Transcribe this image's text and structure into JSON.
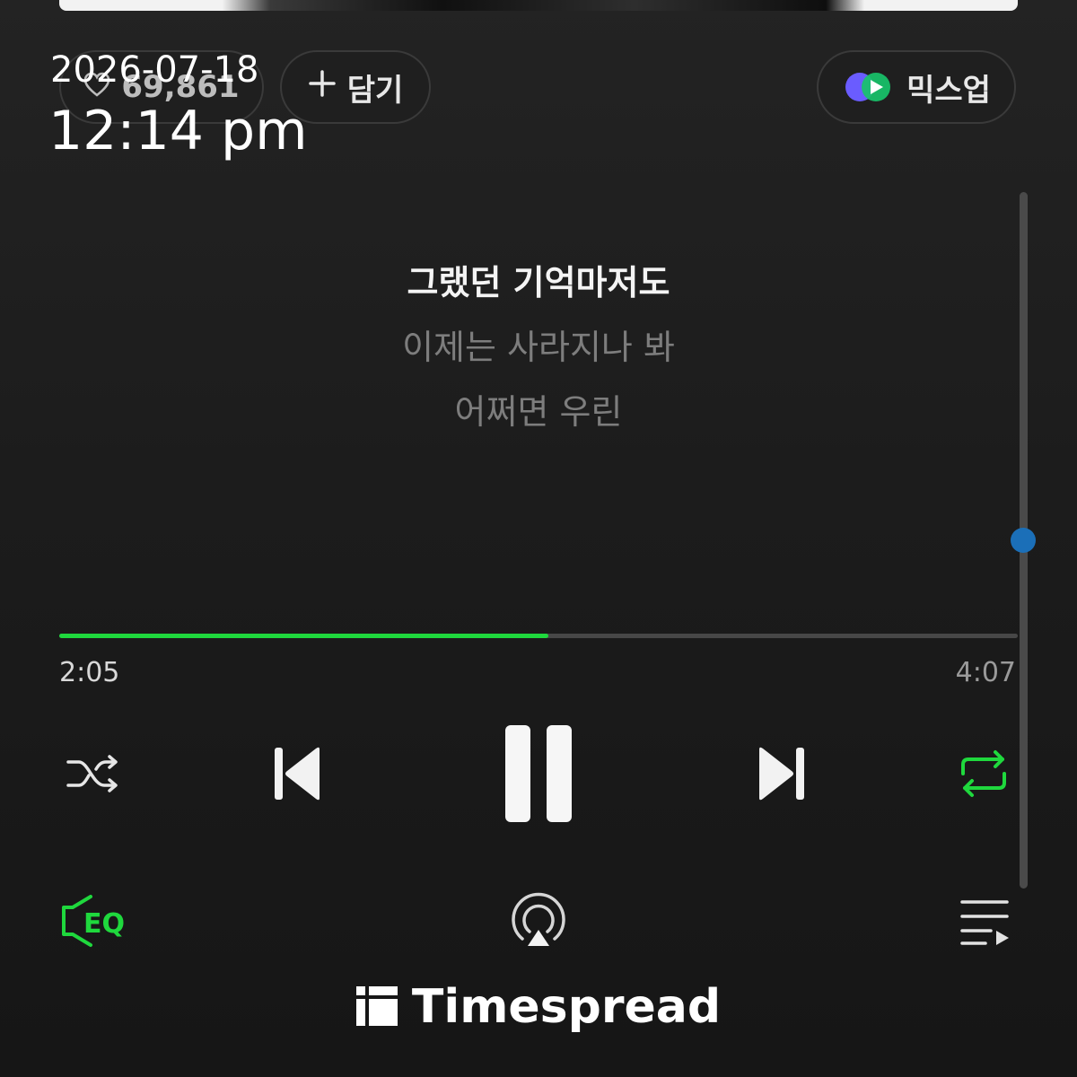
{
  "header": {
    "like_count": "69,861",
    "add_label": "담기",
    "mixup_label": "믹스업"
  },
  "overlay": {
    "date": "2026-07-18",
    "time": "12:14 pm"
  },
  "lyrics": [
    "그랬던 기억마저도",
    "이제는 사라지나 봐",
    "어쩌면 우린"
  ],
  "playback": {
    "elapsed": "2:05",
    "total": "4:07",
    "progress_fraction": 0.51,
    "lyrics_scroll_fraction": 0.5,
    "shuffle": "off",
    "repeat": "on"
  },
  "controls": {
    "shuffle_icon": "shuffle-icon",
    "previous_icon": "skip-previous-icon",
    "pause_icon": "pause-icon",
    "next_icon": "skip-next-icon",
    "repeat_icon": "repeat-icon",
    "eq_icon": "equalizer-icon",
    "eq_label": "EQ",
    "airplay_icon": "airplay-icon",
    "playlist_icon": "playlist-icon"
  },
  "watermark": {
    "name": "Timespread"
  },
  "colors": {
    "accent_green": "#1fd83d",
    "background": "#1c1c1c",
    "scroll_thumb": "#1b6fb8"
  }
}
